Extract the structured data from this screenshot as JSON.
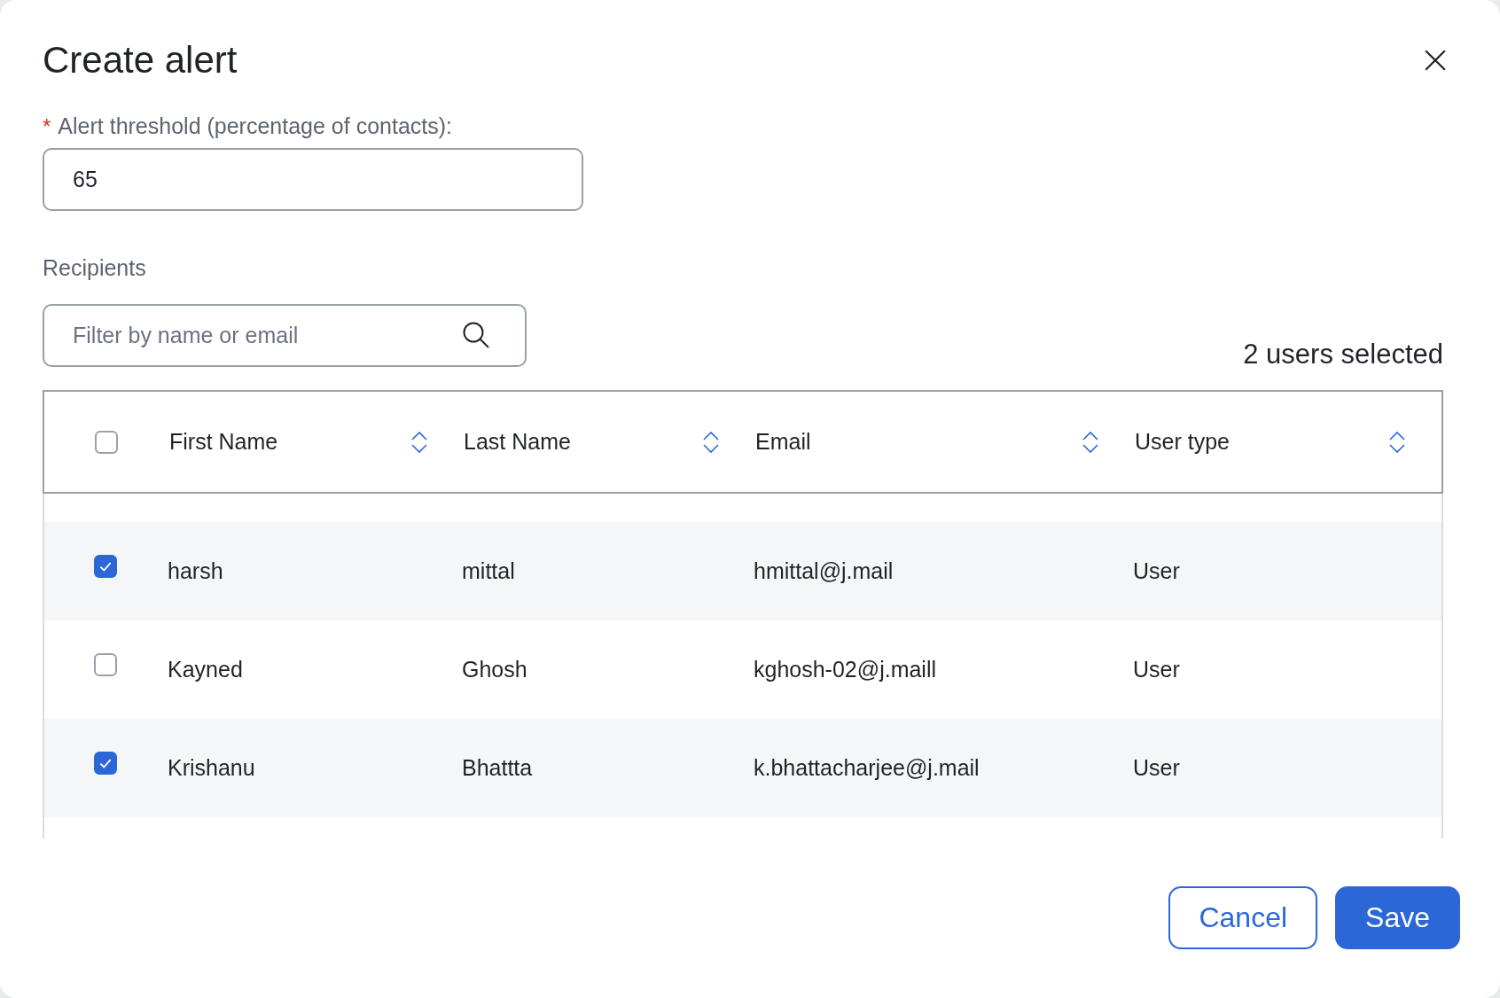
{
  "dialog": {
    "title": "Create alert"
  },
  "threshold": {
    "label": "Alert threshold (percentage of contacts):",
    "required_mark": "*",
    "value": "65"
  },
  "recipients": {
    "label": "Recipients",
    "search": {
      "placeholder": "Filter by name or email"
    },
    "selected_count": "2 users selected"
  },
  "table": {
    "select_all": {
      "checked": false
    },
    "columns": [
      "First Name",
      "Last Name",
      "Email",
      "User type"
    ],
    "rows": [
      {
        "checked": true,
        "cells": [
          "harsh",
          "mittal",
          "hmittal@j.mail",
          "User"
        ]
      },
      {
        "checked": false,
        "cells": [
          "Kayned",
          "Ghosh",
          "kghosh-02@j.maill",
          "User"
        ]
      },
      {
        "checked": true,
        "cells": [
          "Krishanu",
          "Bhattta",
          "k.bhattacharjee@j.mail",
          "User"
        ]
      }
    ]
  },
  "buttons": [
    {
      "label": "Cancel",
      "kind": "secondary"
    },
    {
      "label": "Save",
      "kind": "primary"
    }
  ]
}
